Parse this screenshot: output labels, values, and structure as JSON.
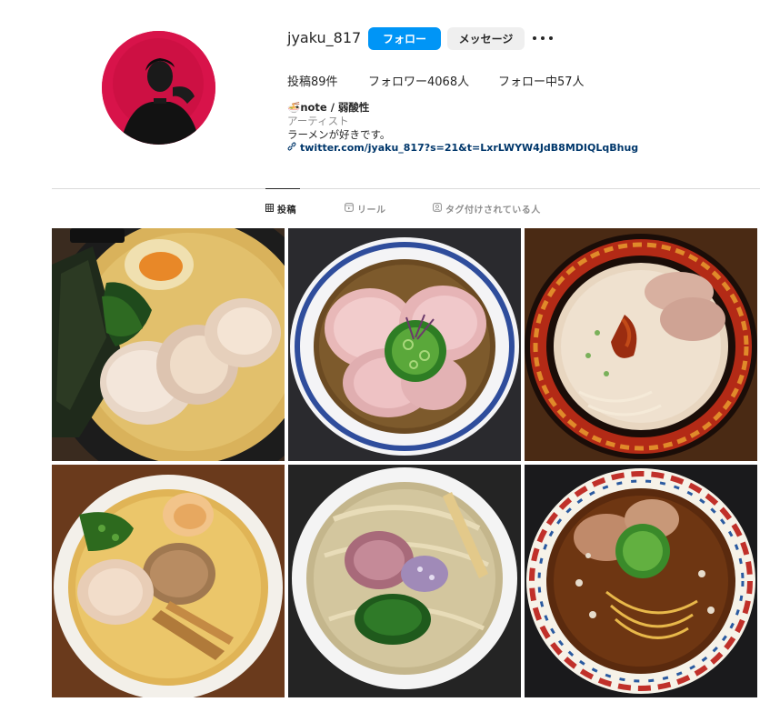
{
  "profile": {
    "username": "jyaku_817",
    "follow_label": "フォロー",
    "message_label": "メッセージ",
    "more_icon": "more-horizontal-icon"
  },
  "stats": {
    "posts": "投稿89件",
    "followers": "フォロワー4068人",
    "following": "フォロー中57人"
  },
  "bio": {
    "name": "🍜note / 弱酸性",
    "category": "アーティスト",
    "description": "ラーメンが好きです。",
    "link": "twitter.com/jyaku_817?s=21&t=LxrLWYW4JdB8MDIQLqBhug"
  },
  "tabs": [
    {
      "label": "投稿",
      "icon": "grid-icon"
    },
    {
      "label": "リール",
      "icon": "reels-icon"
    },
    {
      "label": "タグ付けされている人",
      "icon": "tagged-icon"
    }
  ],
  "colors": {
    "accent": "#0095f6",
    "secondary_button": "#efefef",
    "text": "#262626",
    "muted": "#8e8e8e",
    "link": "#00376b"
  }
}
